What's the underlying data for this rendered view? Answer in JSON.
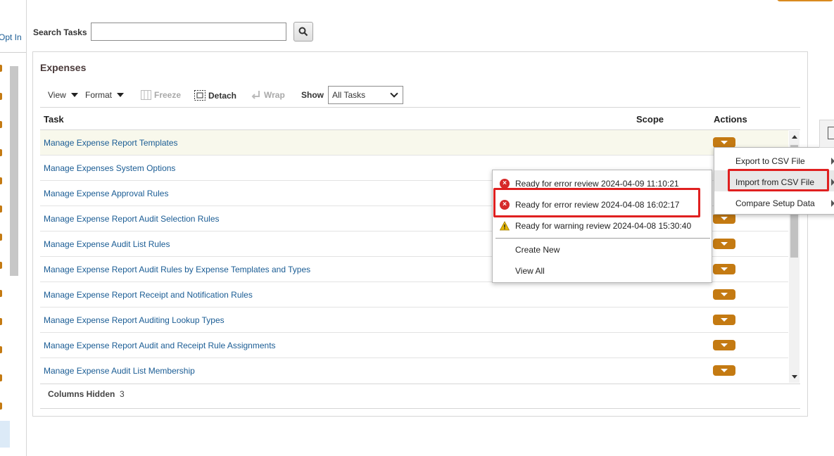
{
  "left_strip": {
    "opt_in_label": "Opt In"
  },
  "search": {
    "label": "Search Tasks",
    "value": "",
    "button_icon": "search-icon"
  },
  "panel": {
    "title": "Expenses"
  },
  "toolbar": {
    "view_label": "View",
    "format_label": "Format",
    "freeze_label": "Freeze",
    "detach_label": "Detach",
    "wrap_label": "Wrap",
    "show_label": "Show",
    "show_value": "All Tasks"
  },
  "table": {
    "headers": {
      "task": "Task",
      "scope": "Scope",
      "actions": "Actions"
    },
    "rows": [
      {
        "task": "Manage Expense Report Templates"
      },
      {
        "task": "Manage Expenses System Options"
      },
      {
        "task": "Manage Expense Approval Rules"
      },
      {
        "task": "Manage Expense Report Audit Selection Rules"
      },
      {
        "task": "Manage Expense Audit List Rules"
      },
      {
        "task": "Manage Expense Report Audit Rules by Expense Templates and Types"
      },
      {
        "task": "Manage Expense Report Receipt and Notification Rules"
      },
      {
        "task": "Manage Expense Report Auditing Lookup Types"
      },
      {
        "task": "Manage Expense Report Audit and Receipt Rule Assignments"
      },
      {
        "task": "Manage Expense Audit List Membership"
      }
    ],
    "columns_hidden_label": "Columns Hidden",
    "columns_hidden_count": "3"
  },
  "popup_menu": {
    "items": [
      {
        "label": "Ready for error review 2024-04-09 11:10:21",
        "icon": "error-icon"
      },
      {
        "label": "Ready for error review 2024-04-08 16:02:17",
        "icon": "error-icon"
      },
      {
        "label": "Ready for warning review 2024-04-08 15:30:40",
        "icon": "warning-icon"
      }
    ],
    "create_new": "Create New",
    "view_all": "View All"
  },
  "actions_menu": {
    "items": [
      {
        "label": "Export to CSV File"
      },
      {
        "label": "Import from CSV File"
      },
      {
        "label": "Compare Setup Data"
      }
    ]
  },
  "colors": {
    "link": "#1a5c94",
    "action_button": "#c47a12",
    "highlight_box": "#e02020",
    "error": "#d62a2a",
    "warning": "#e6b800"
  }
}
